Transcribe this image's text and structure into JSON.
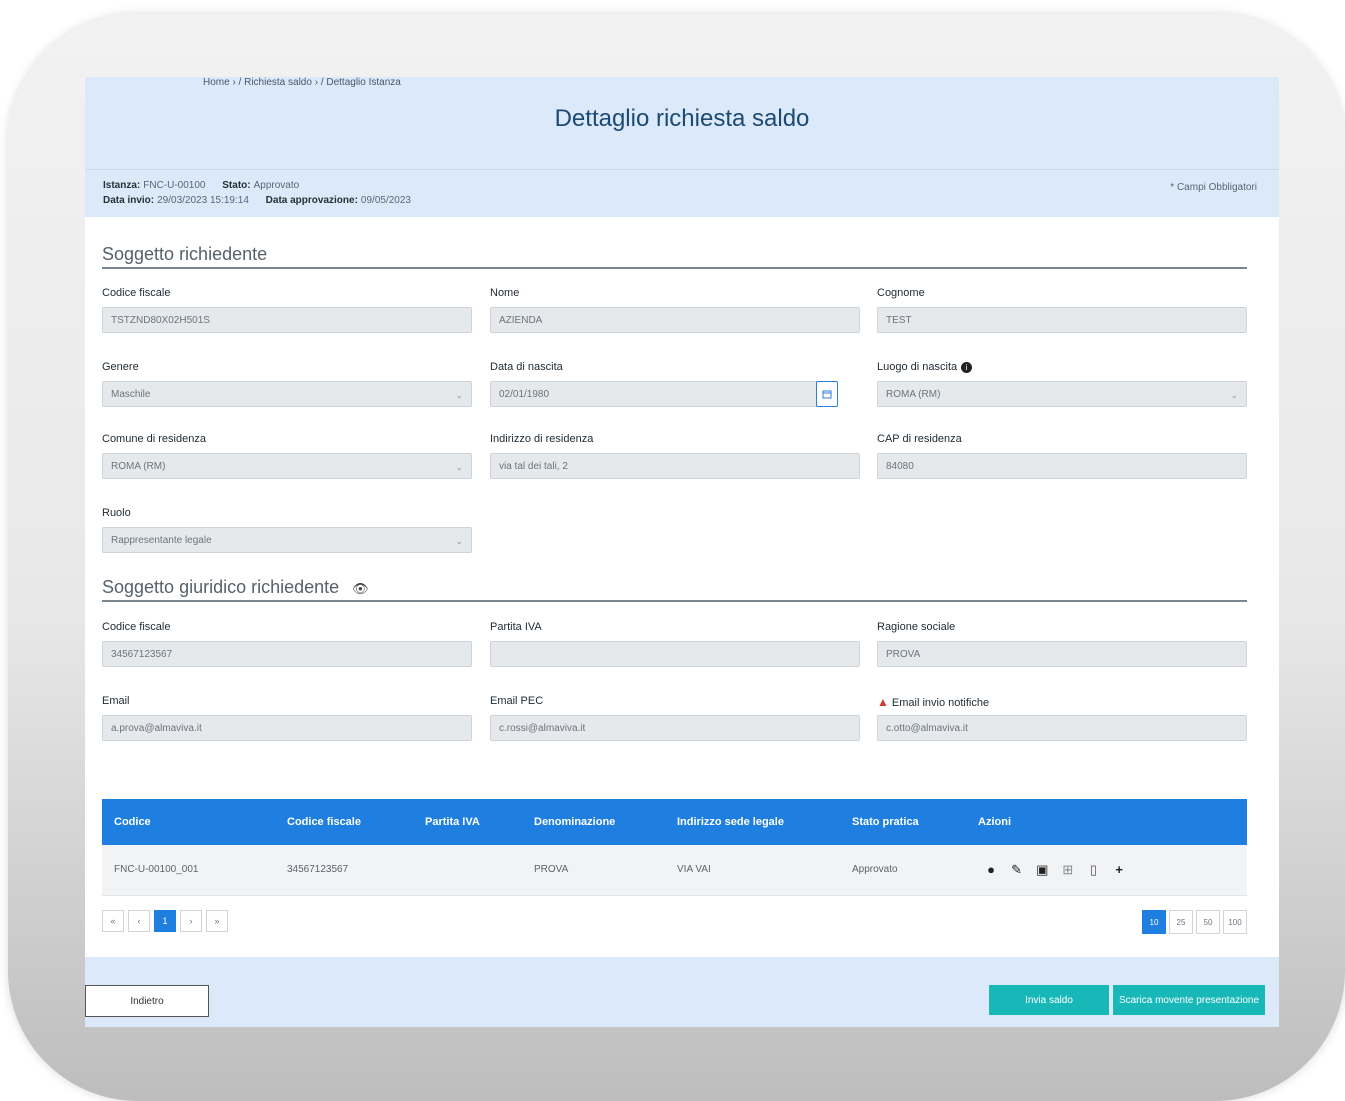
{
  "breadcrumb": "Home › / Richiesta saldo › / Dettaglio Istanza",
  "page_title": "Dettaglio richiesta saldo",
  "info": {
    "istanza_label": "Istanza:",
    "istanza_value": "FNC-U-00100",
    "stato_label": "Stato:",
    "stato_value": "Approvato",
    "data_invio_label": "Data invio:",
    "data_invio_value": "29/03/2023 15:19:14",
    "data_approvazione_label": "Data approvazione:",
    "data_approvazione_value": "09/05/2023",
    "required_note": "* Campi Obbligatori"
  },
  "soggetto": {
    "section_title": "Soggetto richiedente",
    "codice_fiscale_label": "Codice fiscale",
    "codice_fiscale_value": "TSTZND80X02H501S",
    "nome_label": "Nome",
    "nome_value": "AZIENDA",
    "cognome_label": "Cognome",
    "cognome_value": "TEST",
    "genere_label": "Genere",
    "genere_value": "Maschile",
    "data_nascita_label": "Data di nascita",
    "data_nascita_value": "02/01/1980",
    "luogo_nascita_label": "Luogo di nascita",
    "luogo_nascita_value": "ROMA (RM)",
    "comune_label": "Comune di residenza",
    "comune_value": "ROMA (RM)",
    "indirizzo_label": "Indirizzo di residenza",
    "indirizzo_value": "via tal dei tali, 2",
    "cap_label": "CAP di residenza",
    "cap_value": "84080",
    "ruolo_label": "Ruolo",
    "ruolo_value": "Rappresentante legale"
  },
  "giuridico": {
    "section_title": "Soggetto giuridico richiedente",
    "codice_fiscale_label": "Codice fiscale",
    "codice_fiscale_value": "34567123567",
    "partita_iva_label": "Partita IVA",
    "partita_iva_value": "",
    "ragione_label": "Ragione sociale",
    "ragione_value": "PROVA",
    "email_label": "Email",
    "email_value": "a.prova@almaviva.it",
    "pec_label": "Email PEC",
    "pec_value": "c.rossi@almaviva.it",
    "notifiche_label": "Email invio notifiche",
    "notifiche_value": "c.otto@almaviva.it"
  },
  "table": {
    "headers": [
      "Codice",
      "Codice fiscale",
      "Partita IVA",
      "Denominazione",
      "Indirizzo sede legale",
      "Stato pratica",
      "Azioni"
    ],
    "rows": [
      [
        "FNC-U-00100_001",
        "34567123567",
        "",
        "PROVA",
        "VIA VAI",
        "Approvato"
      ]
    ],
    "action_icons": [
      "eye-icon",
      "paperclip-icon",
      "id-card-icon",
      "grid-icon",
      "document-icon",
      "plus-icon"
    ]
  },
  "pager": {
    "first": "«",
    "prev": "‹",
    "current": "1",
    "next": "›",
    "last": "»",
    "sizes": [
      "10",
      "25",
      "50",
      "100"
    ]
  },
  "buttons": {
    "back": "Indietro",
    "send": "Invia saldo",
    "download": "Scarica movente presentazione"
  },
  "colors": {
    "header_bg": "#dbe9fb",
    "title": "#1c4a74",
    "table_header": "#1f7fe0",
    "action_button": "#19b8b8"
  }
}
